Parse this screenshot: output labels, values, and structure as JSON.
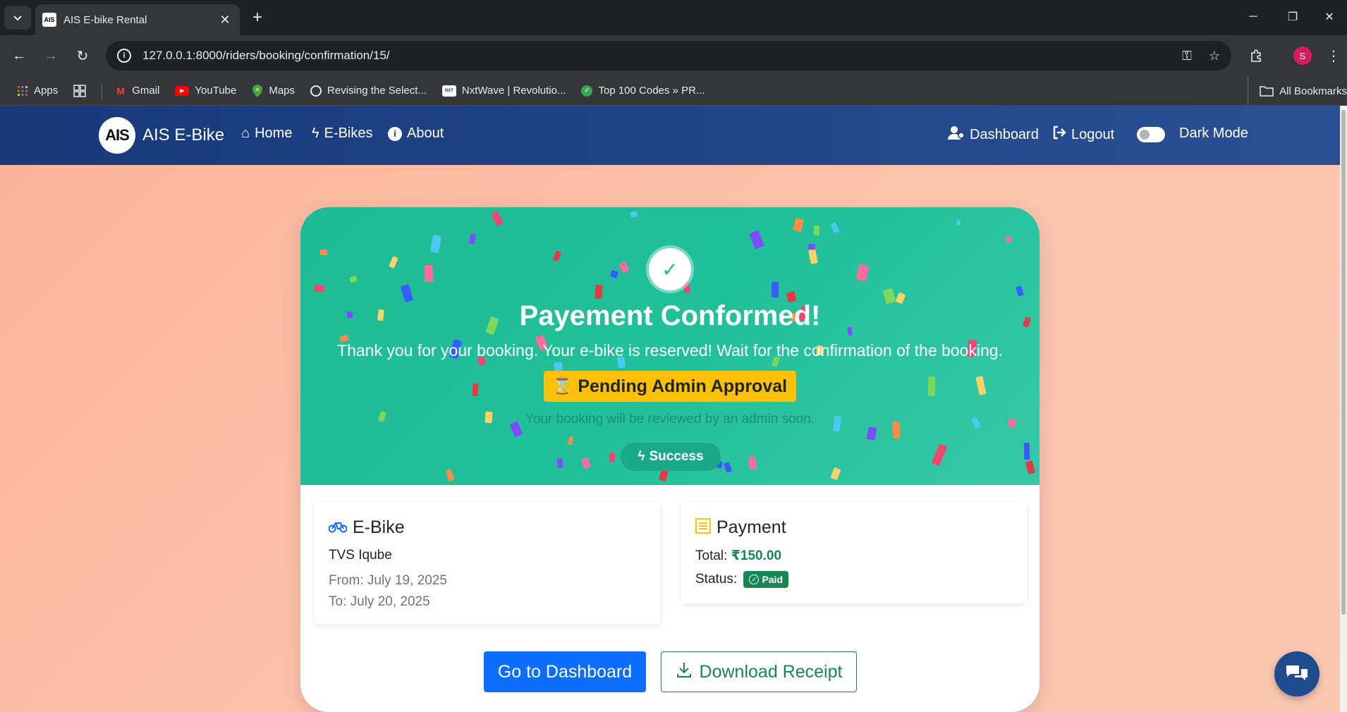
{
  "browser": {
    "tab_title": "AIS E-bike Rental",
    "tab_favicon": "AIS",
    "url": "127.0.0.1:8000/riders/booking/confirmation/15/",
    "profile_initial": "S",
    "bookmarks": [
      {
        "label": "Apps",
        "icon": "apps-grid-icon"
      },
      {
        "label": "Gmail",
        "icon": "gmail-icon"
      },
      {
        "label": "YouTube",
        "icon": "youtube-icon"
      },
      {
        "label": "Maps",
        "icon": "maps-icon"
      },
      {
        "label": "Revising the Select...",
        "icon": "globe-icon"
      },
      {
        "label": "NxtWave | Revolutio...",
        "icon": "nxtwave-icon"
      },
      {
        "label": "Top 100 Codes » PR...",
        "icon": "shield-icon"
      }
    ],
    "all_bookmarks": "All Bookmarks"
  },
  "navbar": {
    "brand_logo": "AIS",
    "brand_name": "AIS E-Bike",
    "links": {
      "home": "Home",
      "ebikes": "E-Bikes",
      "about": "About",
      "dashboard": "Dashboard",
      "logout": "Logout"
    },
    "dark_mode_label": "Dark Mode",
    "dark_mode_on": false
  },
  "confirmation": {
    "title": "Payement Conformed!",
    "subtitle": "Thank you for your booking. Your e-bike is reserved! Wait for the confirmation of the booking.",
    "status_badge": "Pending Admin Approval",
    "review_note": "Your booking will be reviewed by an admin soon.",
    "success_pill": "Success"
  },
  "ebike": {
    "heading": "E-Bike",
    "name": "TVS Iqube",
    "from": "From: July 19, 2025",
    "to": "To: July 20, 2025"
  },
  "payment": {
    "heading": "Payment",
    "total_label": "Total:",
    "total_value": "₹150.00",
    "status_label": "Status:",
    "status_value": "Paid"
  },
  "actions": {
    "dashboard": "Go to Dashboard",
    "receipt": "Download Receipt"
  },
  "colors": {
    "navbar": "#17397a",
    "hero": "#1ebc95",
    "pending": "#ffc107",
    "primary": "#0d6efd",
    "success": "#198754"
  }
}
